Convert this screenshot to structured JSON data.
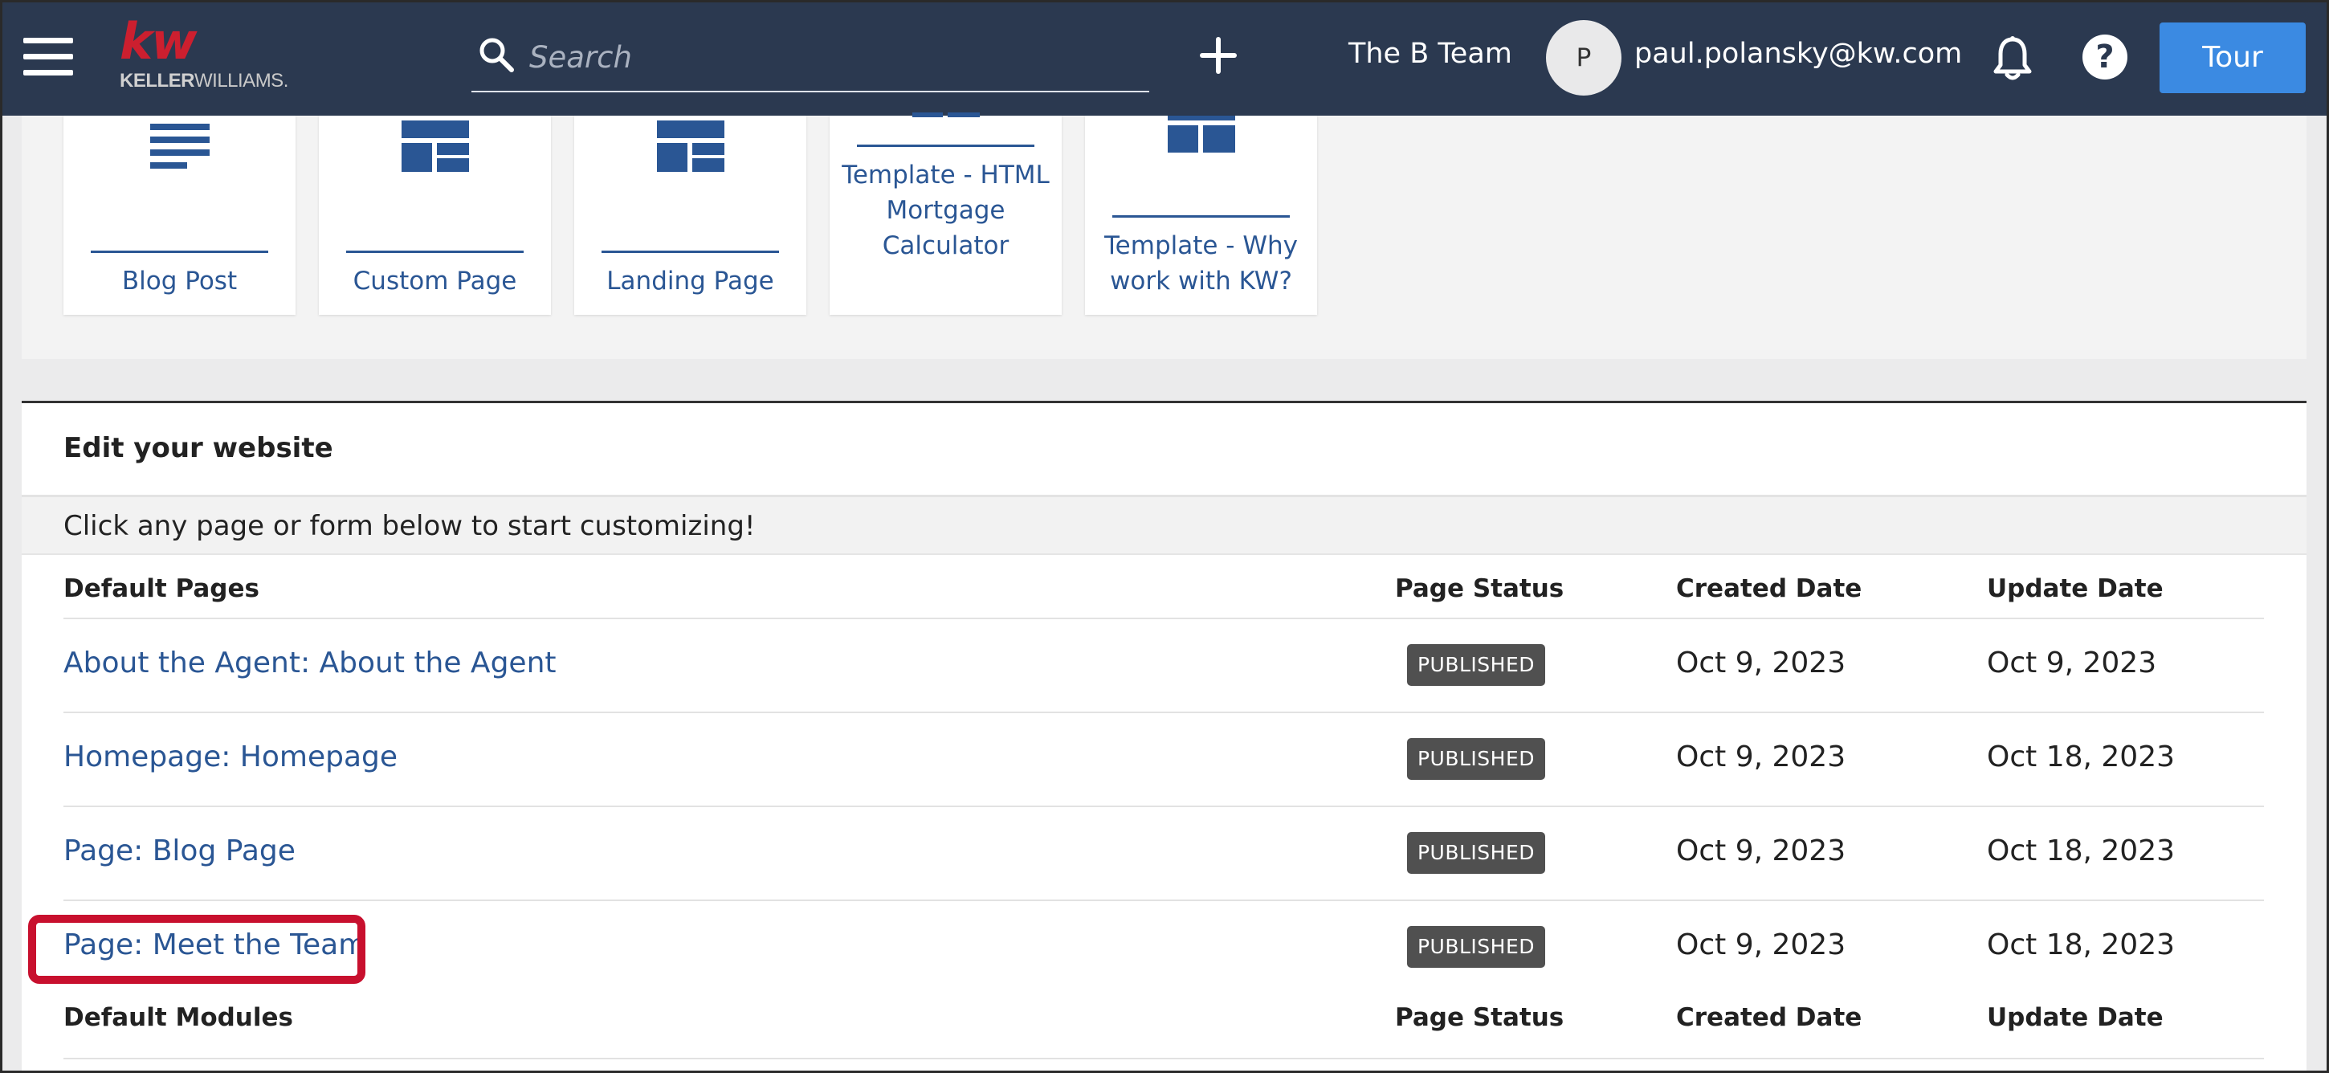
{
  "topbar": {
    "logo_mark": "kw",
    "logo_text_bold": "KELLER",
    "logo_text_light": "WILLIAMS.",
    "search_placeholder": "Search",
    "team_name": "The B Team",
    "avatar_initial": "P",
    "email": "paul.polansky@kw.com",
    "tour_label": "Tour"
  },
  "templates": [
    {
      "label": "Blog Post",
      "icon": "blog-post-icon"
    },
    {
      "label": "Custom Page",
      "icon": "layout-grid-icon"
    },
    {
      "label": "Landing Page",
      "icon": "layout-grid-icon"
    },
    {
      "label": "Template - HTML Mortgage Calculator",
      "icon": "layout-grid-icon"
    },
    {
      "label": "Template - Why work with KW?",
      "icon": "layout-grid-icon"
    }
  ],
  "edit": {
    "title": "Edit your website",
    "hint": "Click any page or form below to start customizing!",
    "pages_header": {
      "name": "Default Pages",
      "status": "Page Status",
      "created": "Created Date",
      "updated": "Update Date"
    },
    "pages": [
      {
        "name": "About the Agent: About the Agent",
        "status": "PUBLISHED",
        "created": "Oct 9, 2023",
        "updated": "Oct 9, 2023"
      },
      {
        "name": "Homepage: Homepage",
        "status": "PUBLISHED",
        "created": "Oct 9, 2023",
        "updated": "Oct 18, 2023"
      },
      {
        "name": "Page: Blog Page",
        "status": "PUBLISHED",
        "created": "Oct 9, 2023",
        "updated": "Oct 18, 2023"
      },
      {
        "name": "Page: Meet the Team",
        "status": "PUBLISHED",
        "created": "Oct 9, 2023",
        "updated": "Oct 18, 2023"
      }
    ],
    "modules_header": {
      "name": "Default Modules",
      "status": "Page Status",
      "created": "Created Date",
      "updated": "Update Date"
    }
  },
  "colors": {
    "topbar": "#2b3950",
    "link": "#2a5694",
    "tour_button": "#3b8ae2",
    "brand_red": "#cc1f2f",
    "highlight": "#c8102e",
    "badge": "#505050"
  }
}
